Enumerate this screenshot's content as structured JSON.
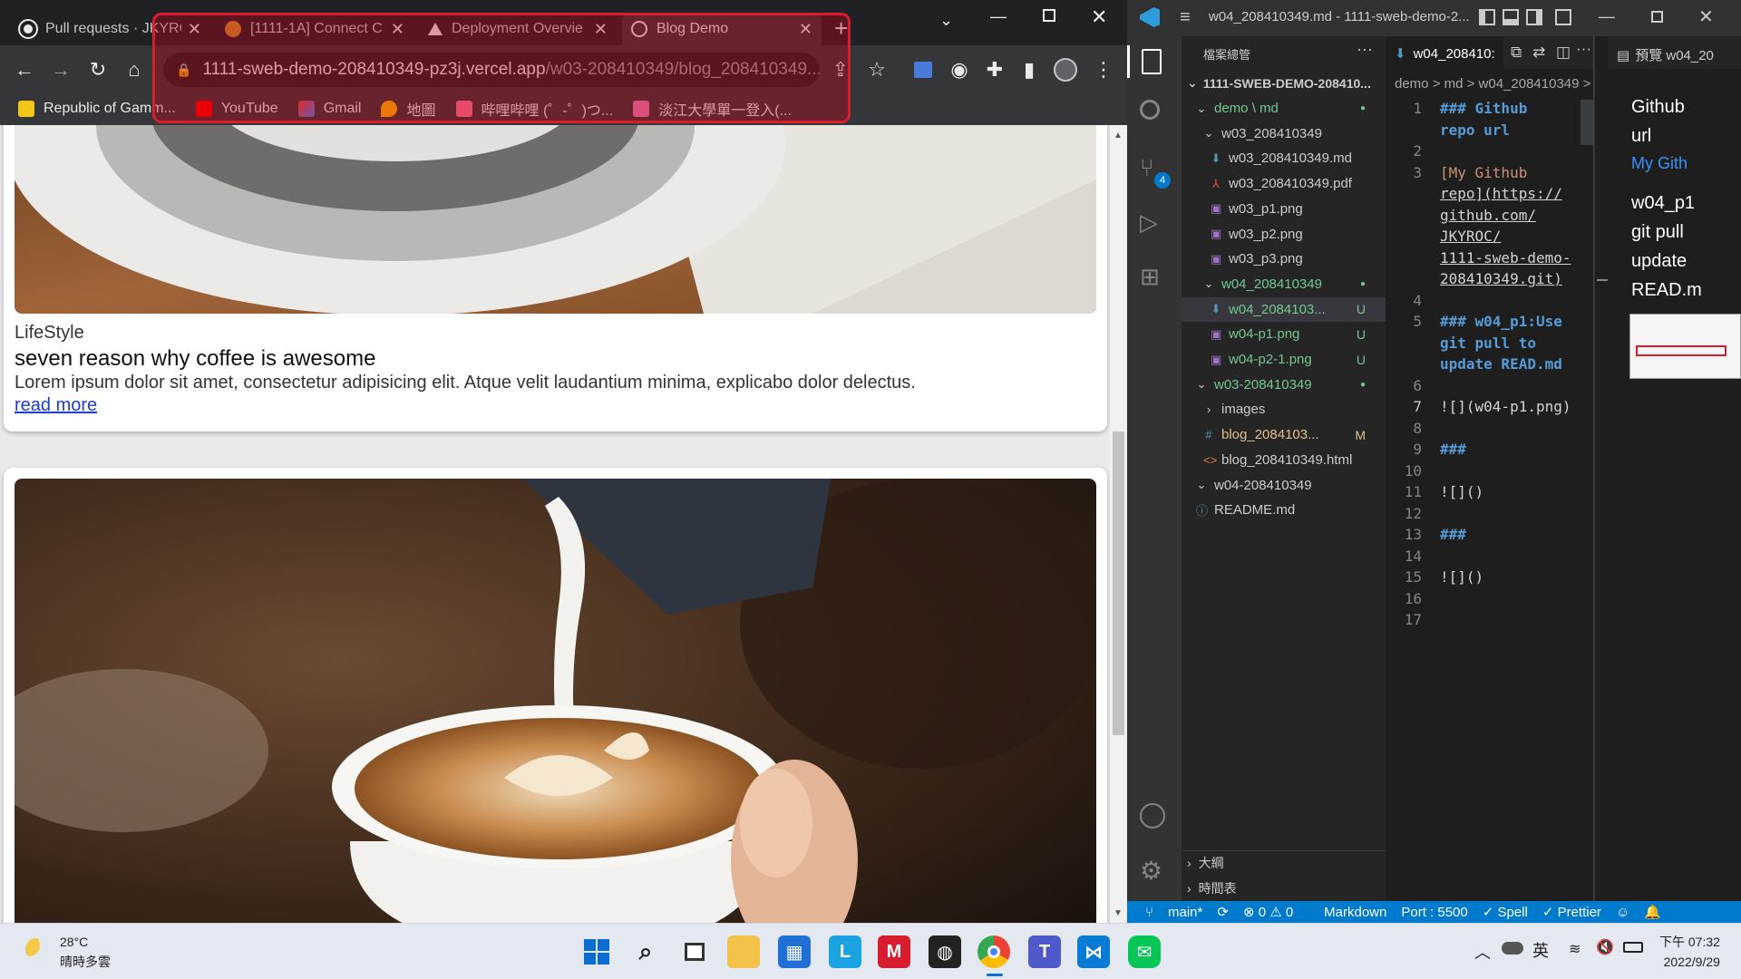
{
  "browser": {
    "tabs": [
      {
        "title": "Pull requests · JKYROC"
      },
      {
        "title": "[1111-1A] Connect C"
      },
      {
        "title": "Deployment Overvie"
      },
      {
        "title": "Blog Demo"
      }
    ],
    "new_tab": "+",
    "url_host": "1111-sweb-demo-208410349-pz3j.vercel.app",
    "url_path": "/w03-208410349/blog_208410349....",
    "bookmarks": [
      "Republic of Gamm...",
      "YouTube",
      "Gmail",
      "地圖",
      "哔哩哔哩 (゜-゜)つ...",
      "淡江大學單一登入(..."
    ]
  },
  "page": {
    "card1": {
      "category": "LifeStyle",
      "title": "seven reason why coffee is awesome",
      "body": "Lorem ipsum dolor sit amet, consectetur adipisicing elit. Atque velit laudantium minima, explicabo dolor delectus.",
      "link": "read more"
    }
  },
  "vscode": {
    "title": "w04_208410349.md - 1111-sweb-demo-2...",
    "explorer_header": "檔案總管",
    "project": "1111-SWEB-DEMO-208410...",
    "tree": [
      {
        "label": "demo \\ md",
        "status": "●",
        "kind": "folder-open"
      },
      {
        "label": "w03_208410349",
        "status": "",
        "kind": "folder-open"
      },
      {
        "label": "w03_208410349.md",
        "status": "",
        "kind": "md"
      },
      {
        "label": "w03_208410349.pdf",
        "status": "",
        "kind": "pdf"
      },
      {
        "label": "w03_p1.png",
        "status": "",
        "kind": "img"
      },
      {
        "label": "w03_p2.png",
        "status": "",
        "kind": "img"
      },
      {
        "label": "w03_p3.png",
        "status": "",
        "kind": "img"
      },
      {
        "label": "w04_208410349",
        "status": "●",
        "kind": "folder-open"
      },
      {
        "label": "w04_2084103...",
        "status": "U",
        "kind": "md"
      },
      {
        "label": "w04-p1.png",
        "status": "U",
        "kind": "img"
      },
      {
        "label": "w04-p2-1.png",
        "status": "U",
        "kind": "img"
      },
      {
        "label": "w03-208410349",
        "status": "●",
        "kind": "folder-open"
      },
      {
        "label": "images",
        "status": "",
        "kind": "folder"
      },
      {
        "label": "blog_2084103...",
        "status": "M",
        "kind": "css"
      },
      {
        "label": "blog_208410349.html",
        "status": "",
        "kind": "html"
      },
      {
        "label": "w04-208410349",
        "status": "",
        "kind": "folder-open"
      },
      {
        "label": "README.md",
        "status": "",
        "kind": "info"
      }
    ],
    "outline": "大綱",
    "timeline": "時間表",
    "editor_tab": "w04_208410:",
    "breadcrumb": "demo > md > w04_208410349 >",
    "line_numbers": [
      "1",
      "2",
      "3",
      "4",
      "5",
      "6",
      "7",
      "8",
      "9",
      "10",
      "11",
      "12",
      "13",
      "14",
      "15",
      "16",
      "17"
    ],
    "code_lines": [
      "### Github",
      "repo url",
      "",
      "[My Github",
      "repo](https://",
      "github.com/",
      "JKYROC/",
      "1111-sweb-demo-",
      "208410349.git)",
      "",
      "### w04_p1:Use",
      "git pull to",
      "update READ.md",
      "",
      "![](w04-p1.png)",
      "",
      "###",
      "",
      "![]()",
      "",
      "###",
      "",
      "![]()"
    ],
    "preview_tab": "預覽 w04_20",
    "preview_lines": [
      "Github",
      "url",
      "My Gith",
      "w04_p1",
      "git pull",
      "update",
      "READ.m"
    ],
    "status": {
      "branch": "main*",
      "problems": "⊗ 0 ⚠ 0",
      "language": "Markdown",
      "port": "Port : 5500",
      "spell": "✓ Spell",
      "prettier": "✓ Prettier",
      "scm_badge": "4"
    }
  },
  "taskbar": {
    "temp": "28°C",
    "weather": "晴時多雲",
    "ime": "英",
    "time": "下午 07:32",
    "date": "2022/9/29"
  }
}
